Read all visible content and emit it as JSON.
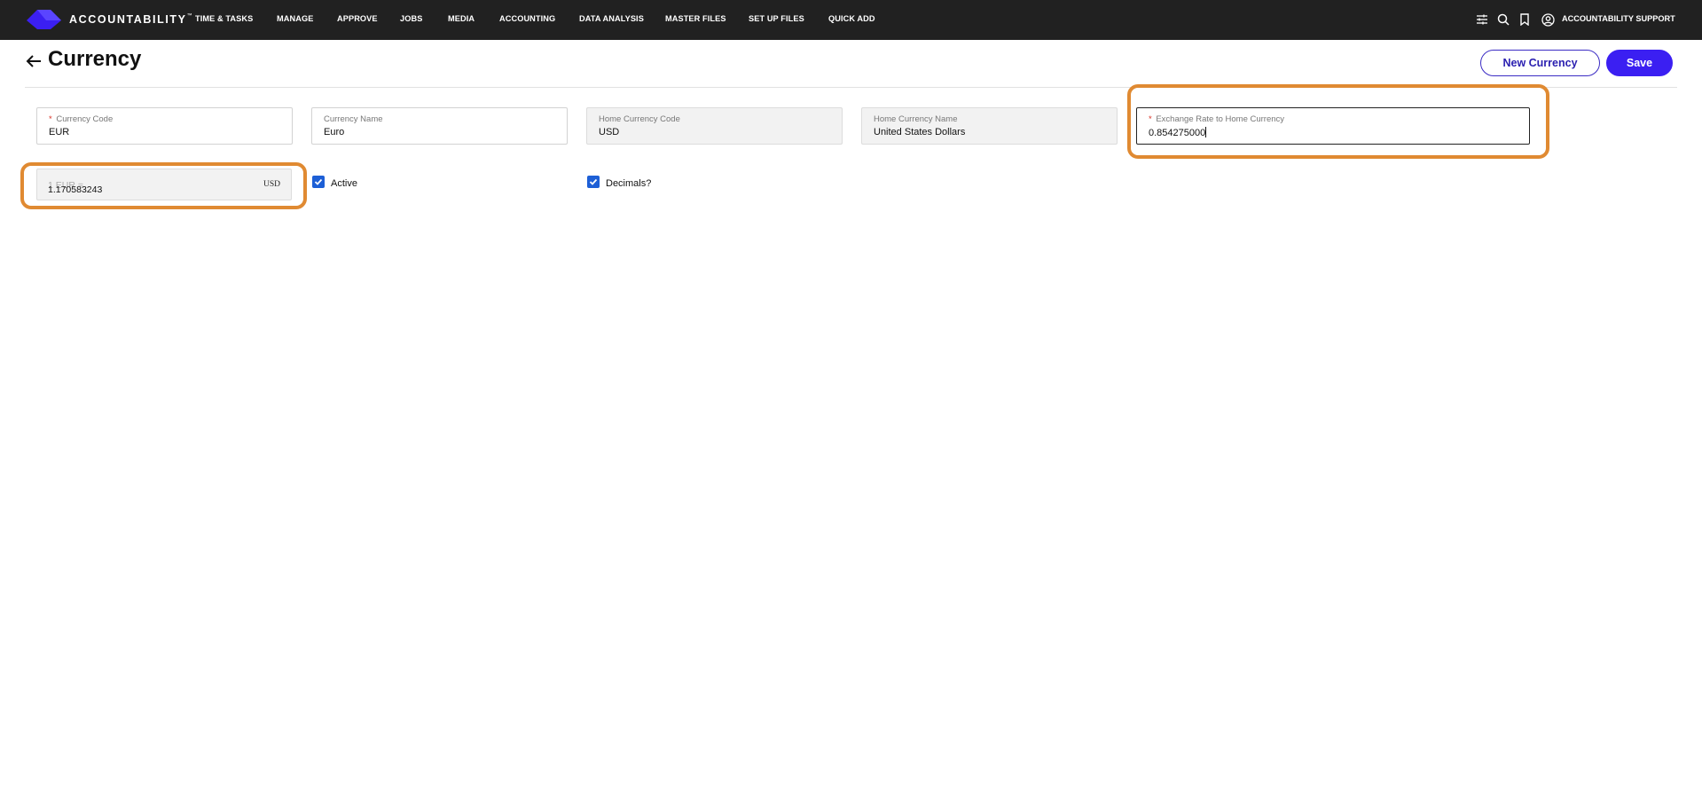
{
  "app": {
    "brand_bold": "ACCOUNTABILITY",
    "brand_tm": "™",
    "accent_color": "#3b1ff2",
    "nav_color": "#212121",
    "highlight_color": "#e08a32"
  },
  "nav": {
    "items": [
      {
        "label": "TIME & TASKS"
      },
      {
        "label": "MANAGE"
      },
      {
        "label": "APPROVE"
      },
      {
        "label": "JOBS"
      },
      {
        "label": "MEDIA"
      },
      {
        "label": "ACCOUNTING"
      },
      {
        "label": "DATA ANALYSIS"
      },
      {
        "label": "MASTER FILES"
      },
      {
        "label": "SET UP FILES"
      },
      {
        "label": "QUICK ADD"
      }
    ],
    "icons": [
      "filter-sliders-icon",
      "search-icon",
      "bookmark-icon",
      "user-circle-icon"
    ],
    "user_label": "ACCOUNTABILITY SUPPORT"
  },
  "header": {
    "title": "Currency",
    "new_button": "New Currency",
    "save_button": "Save"
  },
  "form": {
    "currency_code": {
      "label": "Currency Code",
      "required_mark": "*",
      "value": "EUR"
    },
    "currency_name": {
      "label": "Currency Name",
      "value": "Euro"
    },
    "home_currency_code": {
      "label": "Home Currency Code",
      "value": "USD"
    },
    "home_currency_name": {
      "label": "Home Currency Name",
      "value": "United States Dollars"
    },
    "exchange_rate": {
      "label": "Exchange Rate to Home Currency",
      "required_mark": "*",
      "value": "0.854275000"
    },
    "conversion": {
      "ghost_label": "1 EUR =",
      "value": "1.170583243",
      "unit": "USD"
    },
    "active": {
      "label": "Active",
      "checked": true
    },
    "decimals": {
      "label": "Decimals?",
      "checked": true
    }
  }
}
